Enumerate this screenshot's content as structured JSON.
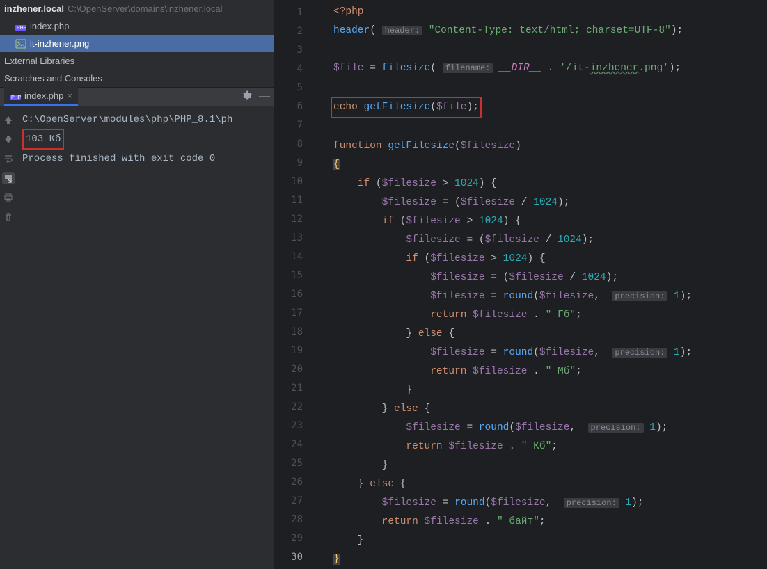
{
  "tree": {
    "project": "inzhener.local",
    "projectPath": "C:\\OpenServer\\domains\\inzhener.local",
    "file1": "index.php",
    "file2": "it-inzhener.png",
    "extLibs": "External Libraries",
    "scratches": "Scratches and Consoles"
  },
  "tab": {
    "name": "index.php"
  },
  "console": {
    "cmd": "C:\\OpenServer\\modules\\php\\PHP_8.1\\ph",
    "result": "103 Кб",
    "exit": "Process finished with exit code 0"
  },
  "code": {
    "l1a": "<?php",
    "l2_fn": "header",
    "l2_hint": "header:",
    "l2_str": "\"Content-Type: text/html; charset=UTF-8\"",
    "l4_var": "$file",
    "l4_fn": "filesize",
    "l4_hint": "filename:",
    "l4_const": "__DIR__",
    "l4_str": "'/it-",
    "l4_str2": "inzhener",
    "l4_str3": ".png'",
    "l6_echo": "echo",
    "l6_fn": "getFilesize",
    "l6_var": "$file",
    "l8_kw": "function",
    "l8_name": "getFilesize",
    "l8_arg": "$filesize",
    "fs": "$filesize",
    "n1024": "1024",
    "round": "round",
    "prec_hint": "precision:",
    "one": "1",
    "ret": "return",
    "gb": "\" Гб\"",
    "mb": "\" Мб\"",
    "kb": "\" Кб\"",
    "bytes": "\" байт\"",
    "if": "if",
    "else": "else"
  },
  "lines": [
    "1",
    "2",
    "3",
    "4",
    "5",
    "6",
    "7",
    "8",
    "9",
    "10",
    "11",
    "12",
    "13",
    "14",
    "15",
    "16",
    "17",
    "18",
    "19",
    "20",
    "21",
    "22",
    "23",
    "24",
    "25",
    "26",
    "27",
    "28",
    "29",
    "30"
  ]
}
